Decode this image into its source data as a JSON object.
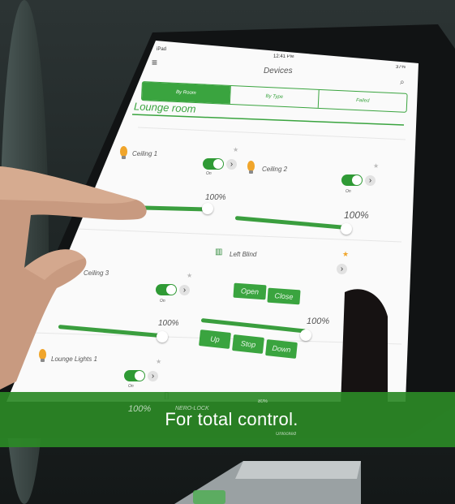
{
  "status_bar": {
    "device": "iPad",
    "time": "12:41 PM",
    "battery": "37%"
  },
  "nav": {
    "title": "Devices",
    "menu_icon": "hamburger-icon",
    "search_icon": "search-icon"
  },
  "filter_tabs": [
    {
      "label": "By Room",
      "selected": true
    },
    {
      "label": "By Type",
      "selected": false
    },
    {
      "label": "Failed",
      "selected": false
    }
  ],
  "room_select": {
    "value": "Lounge room"
  },
  "devices": {
    "ceiling1": {
      "name": "Ceiling 1",
      "state": "On",
      "level": "100%",
      "level_value": 100
    },
    "ceiling2": {
      "name": "Ceiling 2",
      "state": "On",
      "level": "100%",
      "level_value": 100
    },
    "ceiling3": {
      "name": "Ceiling 3",
      "state": "On",
      "level": "100%",
      "level_value": 100
    },
    "left_blind": {
      "name": "Left Blind",
      "level": "100%",
      "level_value": 100,
      "buttons": [
        "Open",
        "Close",
        "Up",
        "Stop",
        "Down"
      ]
    },
    "lounge_lights1": {
      "name": "Lounge Lights 1",
      "state": "On",
      "level": "100%",
      "level_value": 100
    },
    "nero_lock": {
      "name": "NERO-LOCK",
      "battery": "80%",
      "status": "Unlocked"
    }
  },
  "banner": {
    "text": "For total control."
  },
  "colors": {
    "accent_green": "#2f9a35",
    "banner_green": "#2b8926"
  }
}
